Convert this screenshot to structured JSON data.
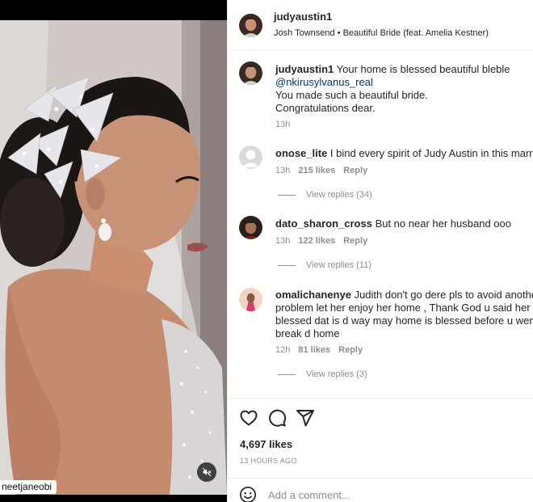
{
  "post": {
    "author": "judyaustin1",
    "audio": "Josh Townsend • Beautiful Bride (feat. Amelia Kestner)",
    "photo_credit": "neetjaneobi"
  },
  "caption": {
    "user": "judyaustin1",
    "line1": "Your home is blessed beautiful bleble",
    "mention": "@nkirusylvanus_real",
    "line3": "You made such a beautiful bride.",
    "line4": "Congratulations dear.",
    "time": "13h"
  },
  "comments": [
    {
      "user": "onose_lite",
      "lines": [
        "I bind every spirit of Judy Austin in this marriage"
      ],
      "time": "13h",
      "likes": "215 likes",
      "reply": "Reply",
      "view_replies": "View replies (34)"
    },
    {
      "user": "dato_sharon_cross",
      "lines": [
        "But no near her husband ooo"
      ],
      "time": "13h",
      "likes": "122 likes",
      "reply": "Reply",
      "view_replies": "View replies (11)"
    },
    {
      "user": "omalichanenye",
      "lines": [
        "Judith don't go dere pls to avoid another",
        "problem let her enjoy her home , Thank God u said her home",
        "blessed dat is d way may home is blessed before u went and",
        "break d home"
      ],
      "time": "12h",
      "likes": "81 likes",
      "reply": "Reply",
      "view_replies": "View replies (3)"
    }
  ],
  "footer": {
    "likes": "4,697 likes",
    "time_ago": "13 HOURS AGO",
    "comment_placeholder": "Add a comment..."
  },
  "icons": {
    "like": "heart-icon",
    "comment": "comment-bubble-icon",
    "share": "paper-plane-icon",
    "emoji": "smiley-icon",
    "mute": "speaker-muted-icon"
  }
}
